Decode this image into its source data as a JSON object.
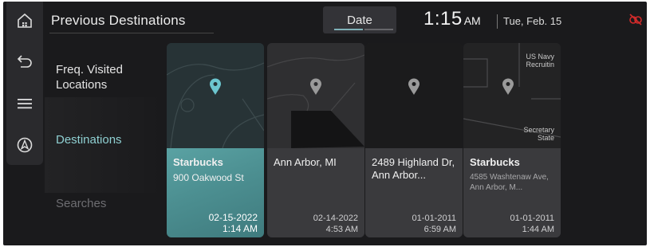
{
  "header": {
    "title": "Previous Destinations",
    "sort_label": "Date",
    "time": "1:15",
    "ampm": "AM",
    "date": "Tue, Feb. 15"
  },
  "rail": {
    "icons": [
      "home-icon",
      "back-icon",
      "menu-icon",
      "navigation-icon"
    ]
  },
  "menu": {
    "items": [
      {
        "label": "Freq. Visited Locations",
        "state": "normal"
      },
      {
        "label": "Destinations",
        "state": "selected"
      },
      {
        "label": "Searches",
        "state": "dimmed"
      }
    ]
  },
  "cards": [
    {
      "title": "Starbucks",
      "subtitle": "900 Oakwood St",
      "date": "02-15-2022",
      "time": "1:14 AM",
      "selected": true
    },
    {
      "title": "Ann Arbor, MI",
      "subtitle": "",
      "date": "02-14-2022",
      "time": "4:53 AM",
      "selected": false
    },
    {
      "title": "2489 Highland Dr, Ann Arbor...",
      "subtitle": "",
      "date": "01-01-2011",
      "time": "6:59 AM",
      "selected": false
    },
    {
      "title": "Starbucks",
      "subtitle": "4585 Washtenaw Ave, Ann Arbor, M...",
      "date": "01-01-2011",
      "time": "1:44 AM",
      "selected": false
    }
  ],
  "map_labels": {
    "card4_top": "US Navy Recruitin",
    "card4_bottom": "Secretary State"
  },
  "colors": {
    "accent": "#8fd0d2",
    "selected_card": "#4c8f91",
    "pin_selected": "#6cc6cf",
    "pin": "#9a9a9a",
    "status_icon": "#d12a2a"
  }
}
